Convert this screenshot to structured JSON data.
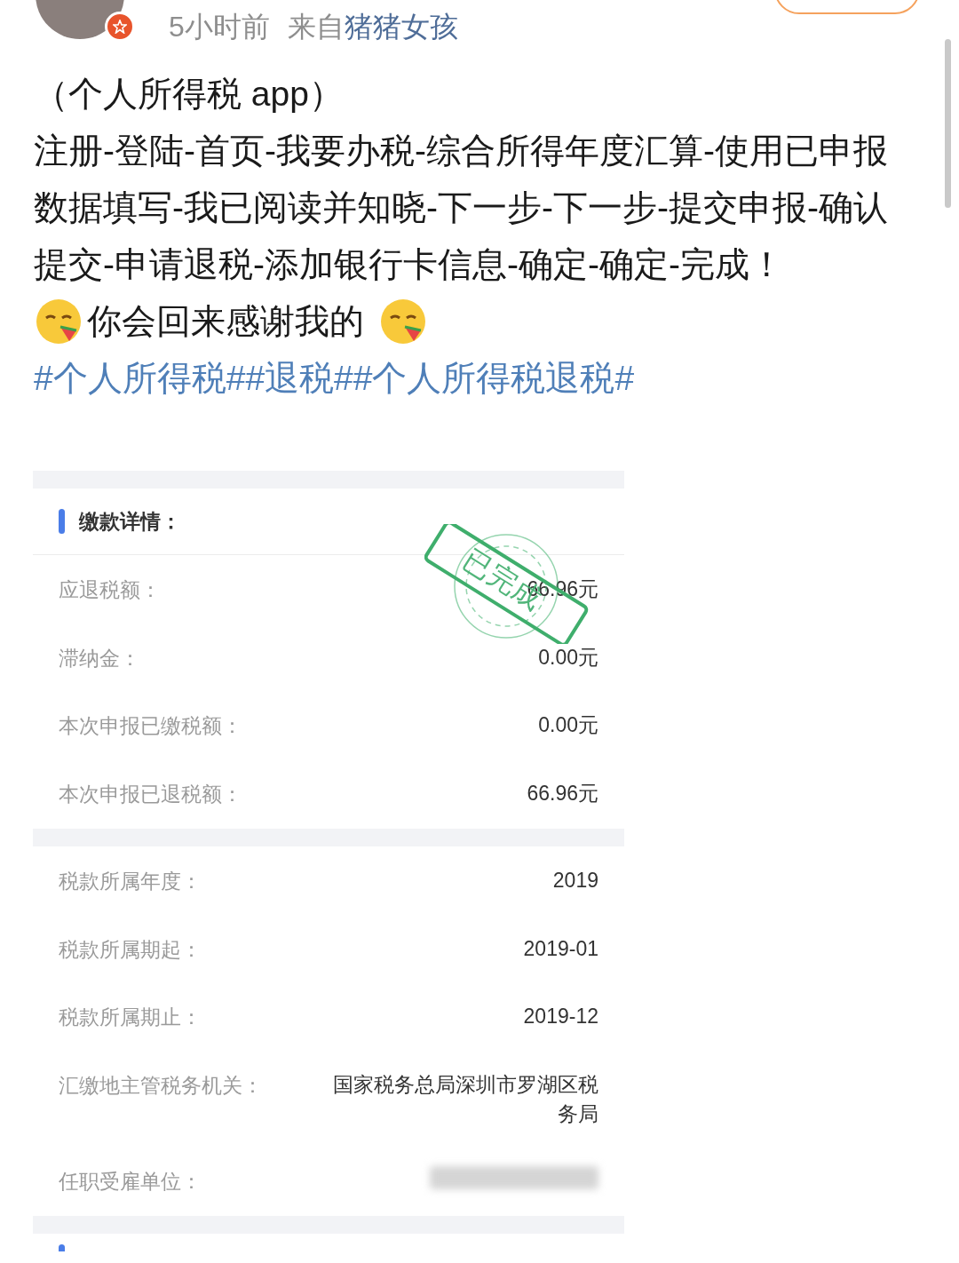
{
  "post_meta": {
    "time": "5小时前",
    "source_prefix": "来自",
    "source": "猪猪女孩"
  },
  "post": {
    "title": "（个人所得税 app）",
    "steps": "注册-登陆-首页-我要办税-综合所得年度汇算-使用已申报数据填写-我已阅读并知晓-下一步-下一步-提交申报-确认提交-申请退税-添加银行卡信息-确定-确定-完成！",
    "emoji_line": "你会回来感谢我的",
    "topics": [
      "#个人所得税#",
      "#退税#",
      "#个人所得税退税#"
    ]
  },
  "receipt": {
    "heading": "缴款详情：",
    "stamp": "已完成",
    "groups": [
      [
        {
          "label": "应退税额：",
          "value": "66.96元"
        },
        {
          "label": "滞纳金：",
          "value": "0.00元"
        },
        {
          "label": "本次申报已缴税额：",
          "value": "0.00元"
        },
        {
          "label": "本次申报已退税额：",
          "value": "66.96元"
        }
      ],
      [
        {
          "label": "税款所属年度：",
          "value": "2019"
        },
        {
          "label": "税款所属期起：",
          "value": "2019-01"
        },
        {
          "label": "税款所属期止：",
          "value": "2019-12"
        },
        {
          "label": "汇缴地主管税务机关：",
          "value": "国家税务总局深圳市罗湖区税务局"
        },
        {
          "label": "任职受雇单位：",
          "blurred": true
        }
      ]
    ]
  }
}
